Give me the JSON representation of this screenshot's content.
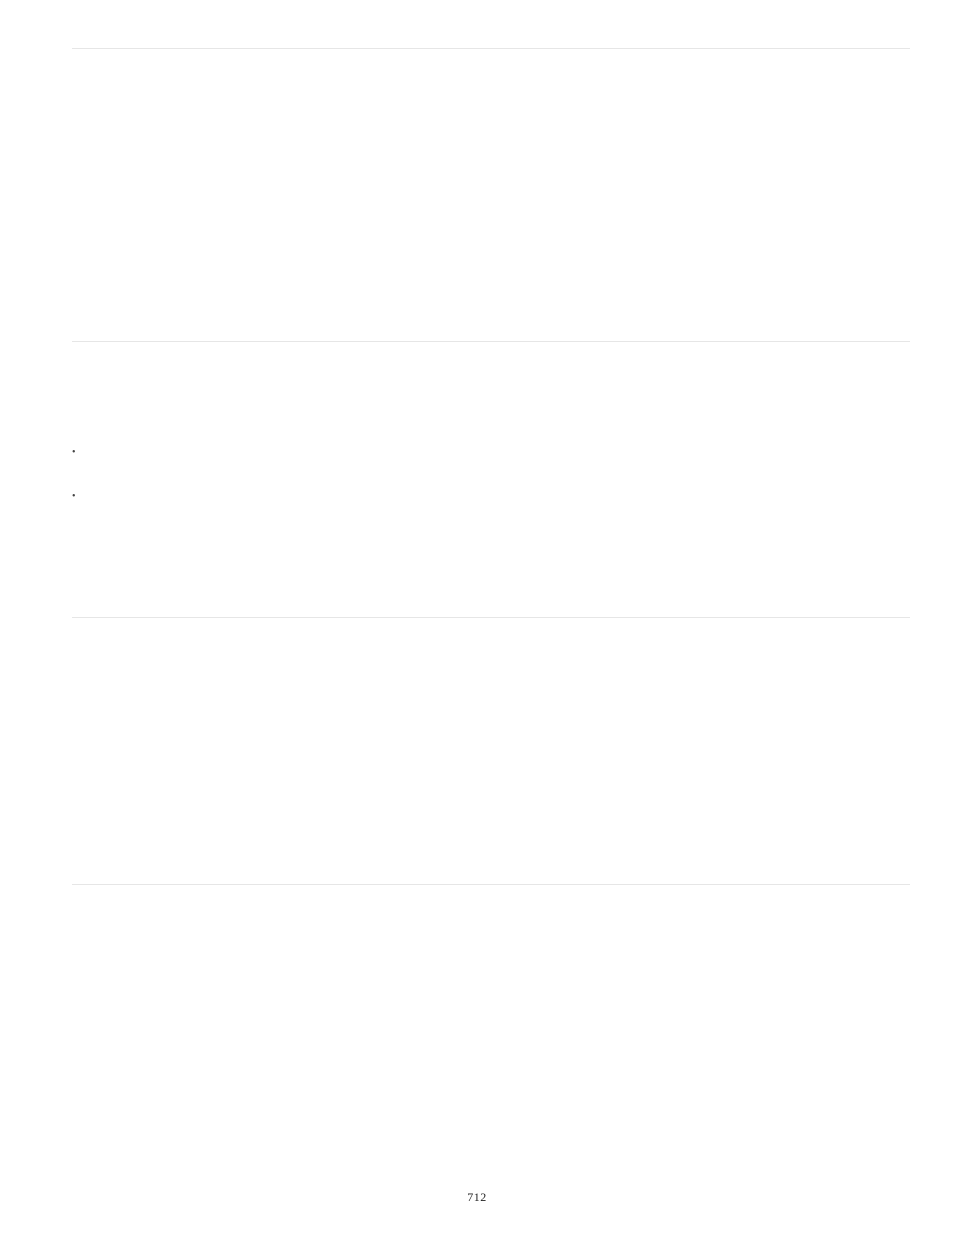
{
  "page_number": "712",
  "bullets": [
    "•",
    "•"
  ]
}
